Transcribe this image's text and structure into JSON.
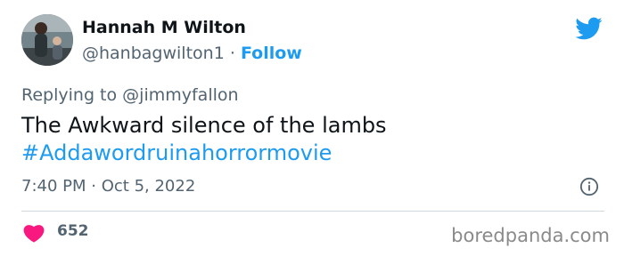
{
  "author": {
    "name": "Hannah M Wilton",
    "handle": "@hanbagwilton1",
    "separator": "·",
    "follow_label": "Follow"
  },
  "reply": {
    "prefix": "Replying to",
    "handle": "@jimmyfallon"
  },
  "tweet": {
    "text": "The Awkward silence of the lambs",
    "hashtag": "#Addawordruinahorrormovie"
  },
  "meta": {
    "time": "7:40 PM",
    "separator": "·",
    "date": "Oct 5, 2022"
  },
  "stats": {
    "likes": "652"
  },
  "watermark": "boredpanda.com",
  "icons": {
    "logo": "twitter-bird-icon",
    "info": "info-icon",
    "like": "heart-icon"
  },
  "colors": {
    "accent": "#1d9bf0",
    "heart": "#f91880",
    "muted": "#536471",
    "text": "#0f1419"
  }
}
